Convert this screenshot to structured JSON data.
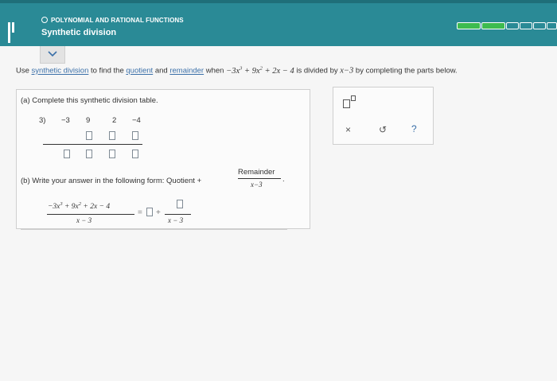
{
  "header": {
    "category": "POLYNOMIAL AND RATIONAL FUNCTIONS",
    "title": "Synthetic division"
  },
  "colors": {
    "header_bg": "#2a8a96",
    "progress_filled": "#3dbb4f",
    "link": "#3a6fa8"
  },
  "question": {
    "prefix": "Use",
    "link1": "synthetic division",
    "mid1": "to find the",
    "link2": "quotient",
    "mid2": "and",
    "link3": "remainder",
    "mid3": "when",
    "poly_terms": [
      "−3x",
      "3",
      "+ 9x",
      "2",
      "+ 2x",
      "− 4"
    ],
    "mid4": "is divided by",
    "divisor": "x−3",
    "suffix": "by completing the parts below."
  },
  "part_a": {
    "label": "(a) Complete this synthetic division table.",
    "divisor_cell": "3)",
    "coefficients": [
      "−3",
      "9",
      "2",
      "−4"
    ]
  },
  "part_b": {
    "label": "(b) Write your answer in the following form: Quotient +",
    "frac_num": "Remainder",
    "frac_den": "x−3",
    "period": ".",
    "lhs_terms": [
      "−3x",
      "3",
      "+ 9x",
      "2",
      "+ 2x − 4"
    ],
    "lhs_den": "x − 3",
    "equals": "=",
    "plus": "+",
    "rhs_den": "x − 3"
  },
  "tools": {
    "clear": "×",
    "undo": "↺",
    "help": "?"
  },
  "icons": [
    "menu-icon",
    "chevron-down-icon",
    "exponent-template-icon",
    "clear-icon",
    "undo-icon",
    "help-icon"
  ]
}
